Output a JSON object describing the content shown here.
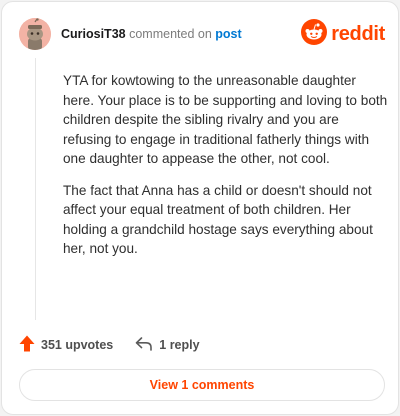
{
  "comment": {
    "author": "CuriosiT38",
    "action_text": "commented on",
    "post_link": "post",
    "paragraphs": [
      "YTA for kowtowing to the unreasonable daughter here. Your place is to be supporting and loving to both children despite the sibling rivalry and you are refusing to engage in traditional fatherly things with one daughter to appease the other, not cool.",
      "The fact that Anna has a child or doesn't should not affect your equal treatment of both children. Her holding a grandchild hostage says everything about her, not you."
    ],
    "upvotes": "351 upvotes",
    "replies": "1 reply",
    "view_comments_label": "View 1 comments"
  },
  "brand": {
    "name": "reddit",
    "color": "#ff4500"
  },
  "icons": {
    "avatar": "snoo-avatar-icon",
    "logo": "reddit-logo-icon",
    "upvote": "upvote-arrow-icon",
    "reply": "reply-arrow-icon"
  }
}
